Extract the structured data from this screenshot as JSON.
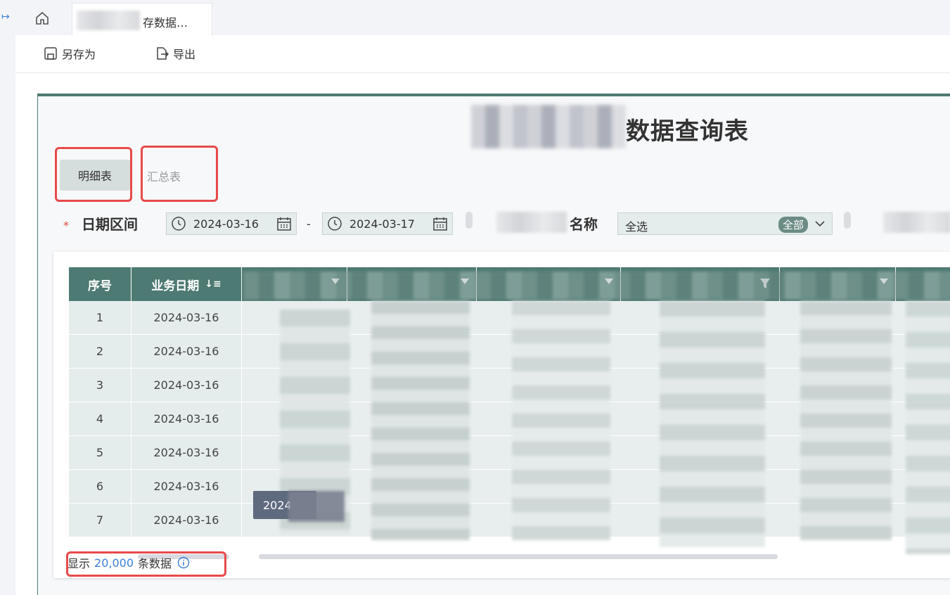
{
  "tabbar": {
    "tab_title": "存数据…"
  },
  "toolbar": {
    "save_as_label": "另存为",
    "export_label": "导出"
  },
  "report": {
    "title_suffix": "数据查询表",
    "views": {
      "detail_label": "明细表",
      "summary_label": "汇总表"
    },
    "filters": {
      "date_range_label": "日期区间",
      "date_start": "2024-03-16",
      "date_separator": "-",
      "date_end": "2024-03-17",
      "name_label_suffix": "名称",
      "name_select_value": "全选",
      "name_select_badge": "全部"
    },
    "table": {
      "columns": [
        "序号",
        "业务日期"
      ],
      "rows": [
        {
          "seq": "1",
          "date": "2024-03-16"
        },
        {
          "seq": "2",
          "date": "2024-03-16"
        },
        {
          "seq": "3",
          "date": "2024-03-16"
        },
        {
          "seq": "4",
          "date": "2024-03-16"
        },
        {
          "seq": "5",
          "date": "2024-03-16"
        },
        {
          "seq": "6",
          "date": "2024-03-16"
        },
        {
          "seq": "7",
          "date": "2024-03-16"
        }
      ],
      "tooltip_text": "2024"
    },
    "footer": {
      "prefix": "显示",
      "count": "20,000",
      "suffix": "条数据"
    }
  },
  "colors": {
    "accent": "#4d7a72",
    "highlight": "#e84a4a",
    "link": "#3d7fd9"
  }
}
